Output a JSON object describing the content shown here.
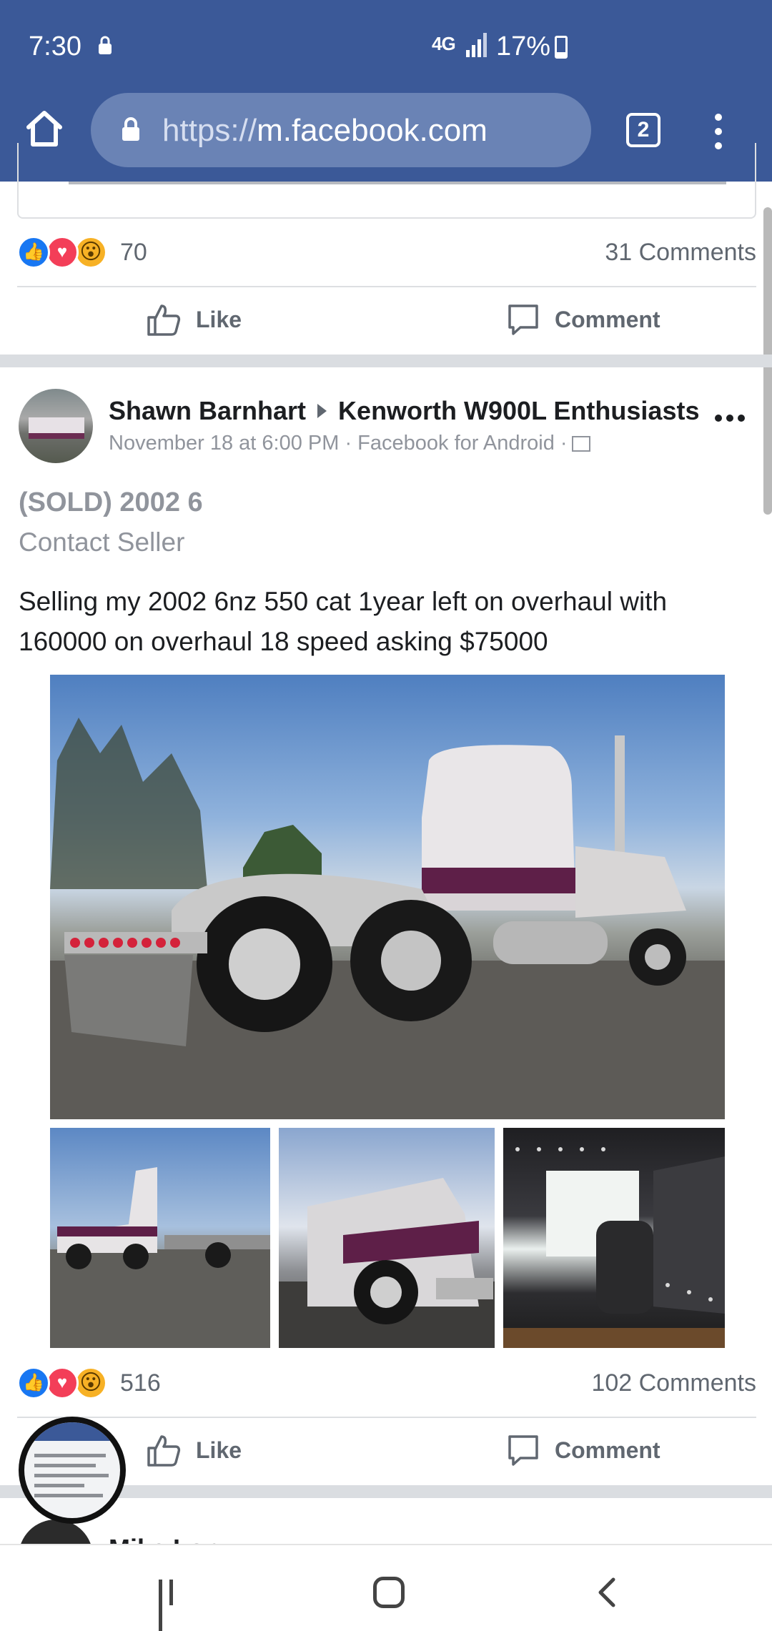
{
  "status_bar": {
    "time": "7:30",
    "network": "4G",
    "battery": "17%"
  },
  "browser": {
    "url_scheme": "https://",
    "url_host": "m.facebook.com",
    "tab_count": "2"
  },
  "previous_post": {
    "reaction_count": "70",
    "comments": "31 Comments",
    "like_label": "Like",
    "comment_label": "Comment"
  },
  "post": {
    "author": "Shawn Barnhart",
    "group": "Kenworth W900L Enthusiasts",
    "meta": "November 18 at 6:00 PM · Facebook for Android ·",
    "sale_title": "(SOLD) 2002 6",
    "sale_subtitle": "Contact Seller",
    "text": "Selling my 2002 6nz 550 cat 1year left on overhaul with 160000 on overhaul 18 speed asking $75000",
    "photo_count_shown": 4,
    "reaction_count": "516",
    "comments": "102 Comments",
    "like_label": "Like",
    "comment_label": "Comment"
  },
  "next_post": {
    "author_peek": "Mike Lop..."
  },
  "colors": {
    "brand": "#3b5998",
    "like_blue": "#1877f2",
    "love_red": "#f33e58",
    "wow_yellow": "#f7b125",
    "muted_text": "#90949c"
  },
  "icons": {
    "reactions": [
      "like-reaction-icon",
      "love-reaction-icon",
      "wow-reaction-icon"
    ],
    "nav": [
      "recent-apps-icon",
      "home-icon",
      "back-icon"
    ]
  }
}
